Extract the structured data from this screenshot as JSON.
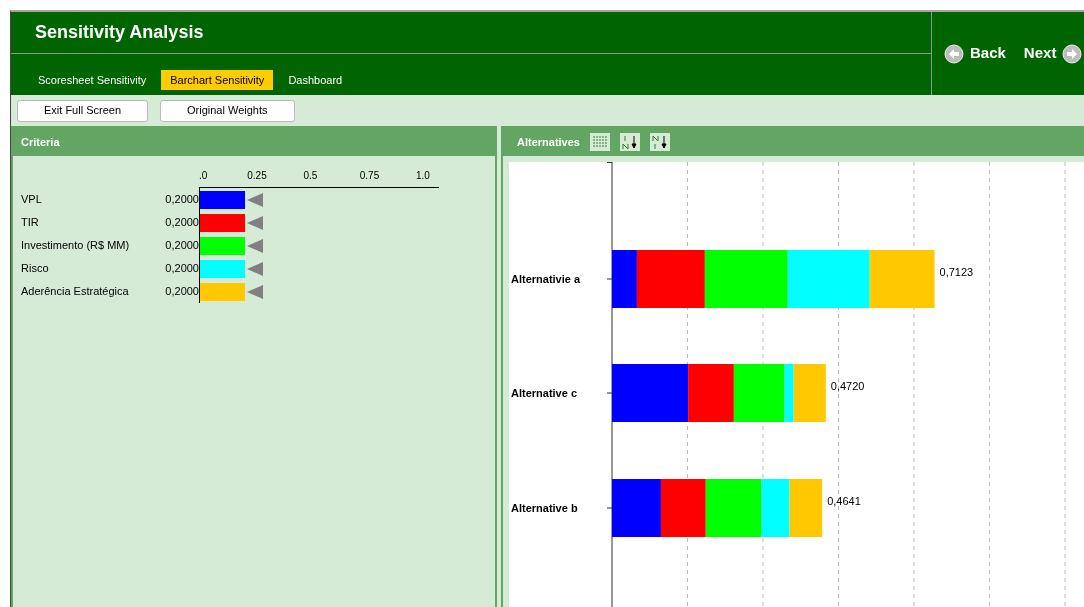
{
  "window": {
    "title": "Sensitivity Analysis"
  },
  "tabs": [
    {
      "label": "Scoresheet Sensitivity",
      "selected": false
    },
    {
      "label": "Barchart Sensitivity",
      "selected": true
    },
    {
      "label": "Dashboard",
      "selected": false
    }
  ],
  "nav": {
    "back": "Back",
    "next": "Next"
  },
  "toolbar": [
    "Exit Full Screen",
    "Original Weights"
  ],
  "criteria": {
    "title": "Criteria",
    "axis_ticks": [
      ".0",
      "0.25",
      "0.5",
      "0.75",
      "1.0"
    ],
    "items": [
      {
        "name": "VPL",
        "value": "0,2000",
        "level": 0.2,
        "color": "#0000ff"
      },
      {
        "name": "TIR",
        "value": "0,2000",
        "level": 0.2,
        "color": "#ff0000"
      },
      {
        "name": "Investimento (R$ MM)",
        "value": "0,2000",
        "level": 0.2,
        "color": "#00ff00"
      },
      {
        "name": "Risco",
        "value": "0,2000",
        "level": 0.2,
        "color": "#00ffff"
      },
      {
        "name": "Aderência Estratégica",
        "value": "0,2000",
        "level": 0.2,
        "color": "#ffc800"
      }
    ]
  },
  "alternatives": {
    "title": "Alternatives",
    "rows": [
      {
        "label": "Alternativie a",
        "total": "0,7123"
      },
      {
        "label": "Alternative c",
        "total": "0,4720"
      },
      {
        "label": "Alternative b",
        "total": "0,4641"
      }
    ]
  }
}
